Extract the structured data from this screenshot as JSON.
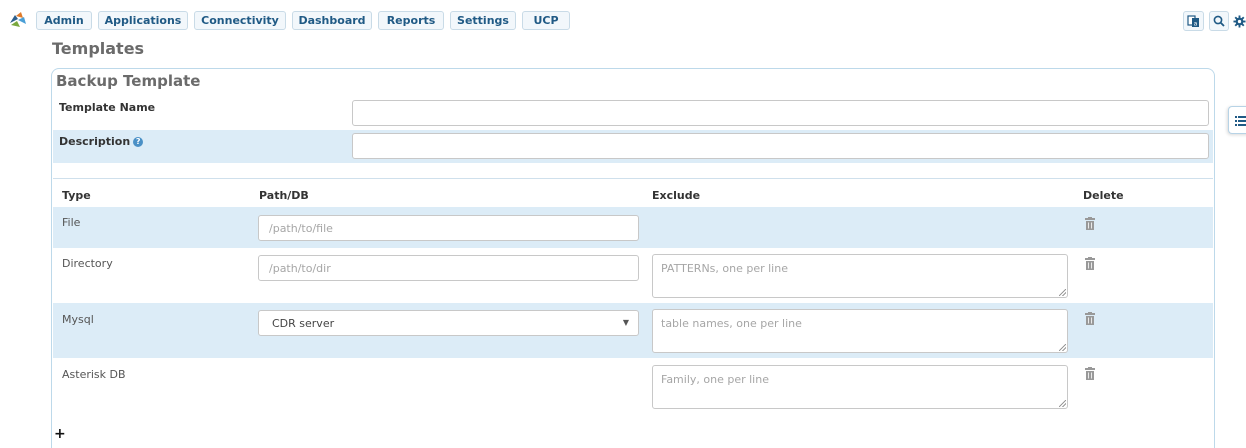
{
  "nav": {
    "items": [
      "Admin",
      "Applications",
      "Connectivity",
      "Dashboard",
      "Reports",
      "Settings",
      "UCP"
    ],
    "right_icons": [
      "language-icon",
      "search-icon",
      "gear-icon"
    ]
  },
  "page_title": "Templates",
  "section_title": "Backup Template",
  "form": {
    "template_name_label": "Template Name",
    "template_name_value": "",
    "description_label": "Description",
    "description_value": ""
  },
  "table": {
    "headers": {
      "type": "Type",
      "path": "Path/DB",
      "exclude": "Exclude",
      "delete": "Delete"
    },
    "rows": [
      {
        "type": "File",
        "path_placeholder": "/path/to/file"
      },
      {
        "type": "Directory",
        "path_placeholder": "/path/to/dir",
        "exclude_placeholder": "PATTERNs, one per line"
      },
      {
        "type": "Mysql",
        "select_value": "CDR server",
        "exclude_placeholder": "table names, one per line"
      },
      {
        "type": "Asterisk DB",
        "exclude_placeholder": "Family, one per line"
      }
    ]
  },
  "add_label": "+",
  "colors": {
    "accent": "#205a85",
    "row_alt": "#dcecf7",
    "border": "#bdd9ea"
  }
}
